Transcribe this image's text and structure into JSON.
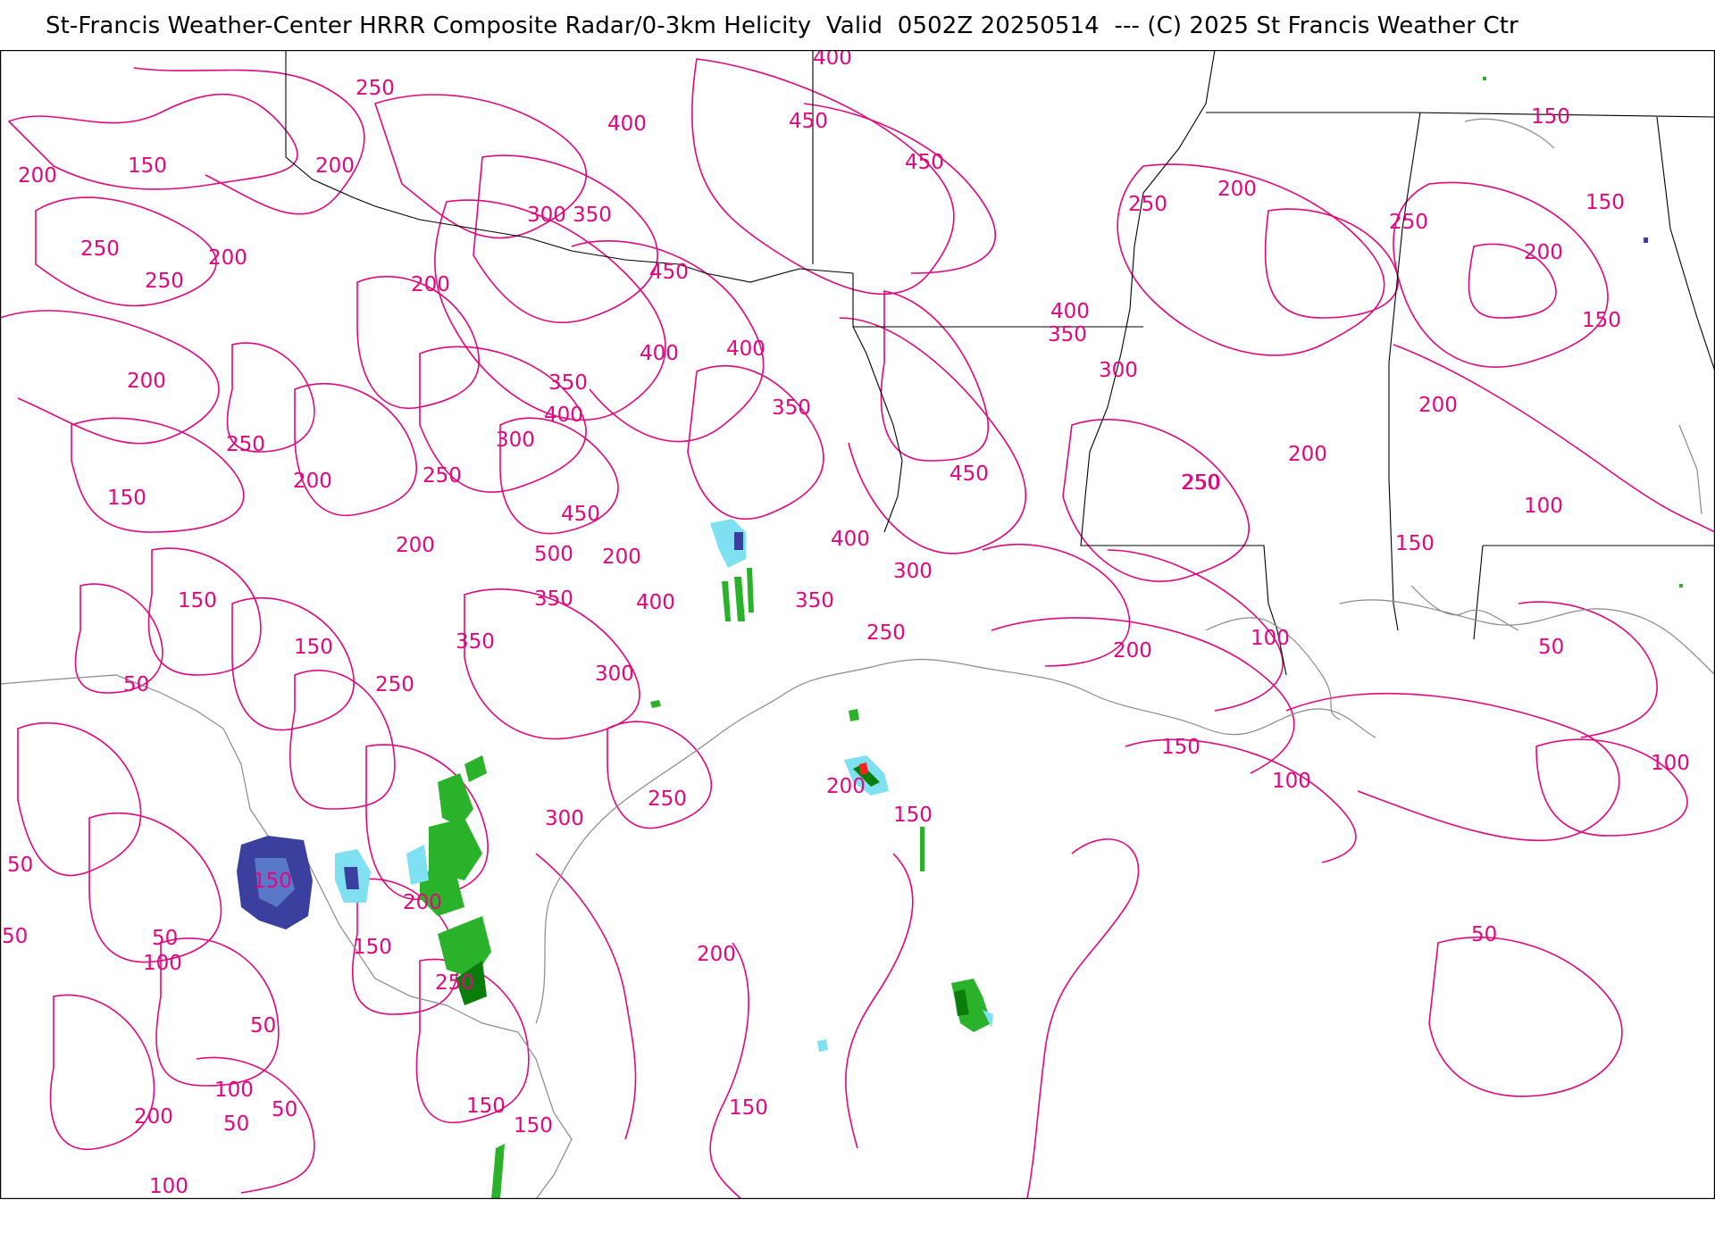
{
  "header": {
    "title": "St-Francis Weather-Center HRRR Composite Radar/0-3km Helicity  Valid  0502Z 20250514  --- (C) 2025 St Francis Weather Ctr"
  },
  "map": {
    "contour_color": "#e0087f",
    "border_color": "#000000",
    "coast_color": "#8a8a8a",
    "radar_colors": {
      "light": "#7ee0f0",
      "moderate": "#2ab32a",
      "heavy": "#0b7d0b",
      "snow": "#3b3f9e",
      "intense": "#ff2020"
    },
    "contour_labels": [
      "400",
      "250",
      "400",
      "450",
      "150",
      "200",
      "150",
      "200",
      "450",
      "250",
      "200",
      "150",
      "300",
      "350",
      "200",
      "250",
      "250",
      "200",
      "200",
      "450",
      "250",
      "400",
      "150",
      "200",
      "400",
      "350",
      "350",
      "300",
      "400",
      "350",
      "200",
      "400",
      "250",
      "250",
      "300",
      "200",
      "150",
      "250",
      "200",
      "450",
      "450",
      "250",
      "500",
      "400",
      "200",
      "100",
      "150",
      "350",
      "150",
      "200",
      "400",
      "350",
      "300",
      "250",
      "350",
      "300",
      "200",
      "150",
      "150",
      "50",
      "100",
      "250",
      "50",
      "300",
      "250",
      "200",
      "150",
      "100",
      "100",
      "200",
      "150",
      "150",
      "250",
      "50",
      "200",
      "150",
      "50",
      "50",
      "100",
      "50",
      "100",
      "50",
      "200",
      "150",
      "150",
      "50",
      "50",
      "100"
    ]
  }
}
